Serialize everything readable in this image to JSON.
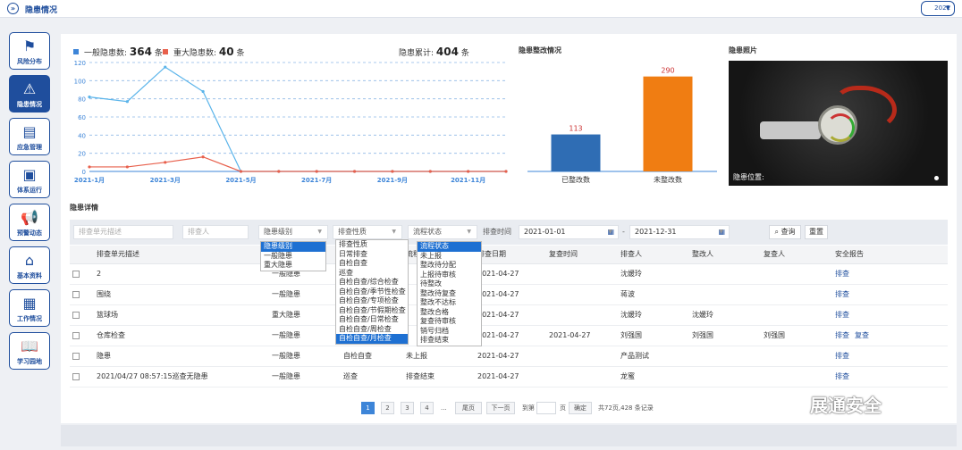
{
  "topbar": {
    "title": "隐患情况",
    "year": "2021"
  },
  "sidebar": [
    {
      "label": "风险分布",
      "icon": "flag-icon",
      "glyph": "⚑",
      "active": false
    },
    {
      "label": "隐患情况",
      "icon": "warning-icon",
      "glyph": "⚠",
      "active": true
    },
    {
      "label": "应急管理",
      "icon": "emergency-doc-icon",
      "glyph": "▤",
      "active": false
    },
    {
      "label": "体系运行",
      "icon": "inbox-icon",
      "glyph": "▣",
      "active": false
    },
    {
      "label": "预警动态",
      "icon": "megaphone-icon",
      "glyph": "📢",
      "active": false
    },
    {
      "label": "基本资料",
      "icon": "home-icon",
      "glyph": "⌂",
      "active": false
    },
    {
      "label": "工作情况",
      "icon": "calendar-icon",
      "glyph": "▦",
      "active": false
    },
    {
      "label": "学习园地",
      "icon": "book-icon",
      "glyph": "📖",
      "active": false
    }
  ],
  "summary": {
    "general_label": "一般隐患数:",
    "general_value": "364",
    "general_unit": "条",
    "major_label": "重大隐患数:",
    "major_value": "40",
    "major_unit": "条",
    "total_label": "隐患累计:",
    "total_value": "404",
    "total_unit": "条",
    "general_color": "#3d85d8",
    "major_color": "#e8604c"
  },
  "chart_data": [
    {
      "type": "line",
      "x": [
        "2021-1月",
        "2021-2月",
        "2021-3月",
        "2021-4月",
        "2021-5月",
        "2021-6月",
        "2021-7月",
        "2021-8月",
        "2021-9月",
        "2021-10月",
        "2021-11月",
        "2021-12月"
      ],
      "x_tick_labels": [
        "2021-1月",
        "2021-3月",
        "2021-5月",
        "2021-7月",
        "2021-9月",
        "2021-11月"
      ],
      "ylim": [
        0,
        120
      ],
      "y_ticks": [
        0,
        20,
        40,
        60,
        80,
        100,
        120
      ],
      "grid": true,
      "series": [
        {
          "name": "一般隐患数",
          "color": "#5ab4ea",
          "values": [
            82,
            77,
            115,
            88,
            0,
            0,
            0,
            0,
            0,
            0,
            0,
            0
          ]
        },
        {
          "name": "重大隐患数",
          "color": "#e8604c",
          "values": [
            5,
            5,
            10,
            16,
            0,
            0,
            0,
            0,
            0,
            0,
            0,
            0
          ]
        }
      ]
    },
    {
      "type": "bar",
      "title": "隐患整改情况",
      "categories": [
        "已整改数",
        "未整改数"
      ],
      "values": [
        113,
        290
      ],
      "colors": [
        "#2f6db4",
        "#f07d12"
      ]
    }
  ],
  "photo": {
    "title": "隐患照片",
    "caption": "隐患位置:"
  },
  "details": {
    "title": "隐患详情"
  },
  "filters": {
    "unit_placeholder": "排查单元描述",
    "person_placeholder": "排查人",
    "level": "隐患级别",
    "nature": "排查性质",
    "status": "流程状态",
    "time_label": "排查时间",
    "date_from": "2021-01-01",
    "date_sep": "-",
    "date_to": "2021-12-31",
    "search": "查询",
    "reset": "重置"
  },
  "columns": [
    "排查单元描述",
    "隐患级别",
    "排查性质",
    "流程状态",
    "排查日期",
    "复查时间",
    "排查人",
    "整改人",
    "复查人",
    "安全报告"
  ],
  "rows": [
    {
      "unit": "2",
      "level": "一般隐患",
      "nature": "",
      "status": "",
      "date": "2021-04-27",
      "recheck": "",
      "checker": "沈媛玲",
      "fixer": "",
      "reviewer": "",
      "report": "排查",
      "report2": ""
    },
    {
      "unit": "围绕",
      "level": "一般隐患",
      "nature": "",
      "status": "",
      "date": "2021-04-27",
      "recheck": "",
      "checker": "蒋波",
      "fixer": "",
      "reviewer": "",
      "report": "排查",
      "report2": ""
    },
    {
      "unit": "篮球场",
      "level": "重大隐患",
      "nature": "",
      "status": "",
      "date": "2021-04-27",
      "recheck": "",
      "checker": "沈媛玲",
      "fixer": "沈媛玲",
      "reviewer": "",
      "report": "排查",
      "report2": ""
    },
    {
      "unit": "仓库检查",
      "level": "一般隐患",
      "nature": "",
      "status": "",
      "date": "2021-04-27",
      "recheck": "2021-04-27",
      "checker": "刘强国",
      "fixer": "刘强国",
      "reviewer": "刘强国",
      "report": "排查",
      "report2": "复查"
    },
    {
      "unit": "隐患",
      "level": "一般隐患",
      "nature": "自检自查",
      "status": "未上报",
      "date": "2021-04-27",
      "recheck": "",
      "checker": "产品测试",
      "fixer": "",
      "reviewer": "",
      "report": "排查",
      "report2": ""
    },
    {
      "unit": "2021/04/27 08:57:15巡查无隐患",
      "level": "一般隐患",
      "nature": "巡查",
      "status": "排查结束",
      "date": "2021-04-27",
      "recheck": "",
      "checker": "龙蜜",
      "fixer": "",
      "reviewer": "",
      "report": "排查",
      "report2": ""
    }
  ],
  "dropdowns": {
    "level": [
      "隐患级别",
      "一般隐患",
      "重大隐患"
    ],
    "level_selected": 0,
    "nature": [
      "排查性质",
      "日常排查",
      "自检自查",
      "巡查",
      "自检自查/综合检查",
      "自检自查/季节性检查",
      "自检自查/专项检查",
      "自检自查/节假期检查",
      "自检自查/日常检查",
      "自检自查/周检查",
      "自检自查/月检查"
    ],
    "nature_selected": 10,
    "status": [
      "流程状态",
      "未上报",
      "整改待分配",
      "上报待审核",
      "待整改",
      "整改待复查",
      "整改不达标",
      "整改合格",
      "复查待审核",
      "销号归档",
      "排查结束"
    ],
    "status_selected": 0
  },
  "pagination": {
    "pages": [
      "1",
      "2",
      "3",
      "4"
    ],
    "current": "1",
    "ellipsis": "...",
    "first": "尾页",
    "next": "下一页",
    "goto_label": "到第",
    "page_unit": "页",
    "confirm": "确定",
    "summary": "共72页,428 条记录"
  },
  "brand": {
    "text": "展通安全"
  }
}
